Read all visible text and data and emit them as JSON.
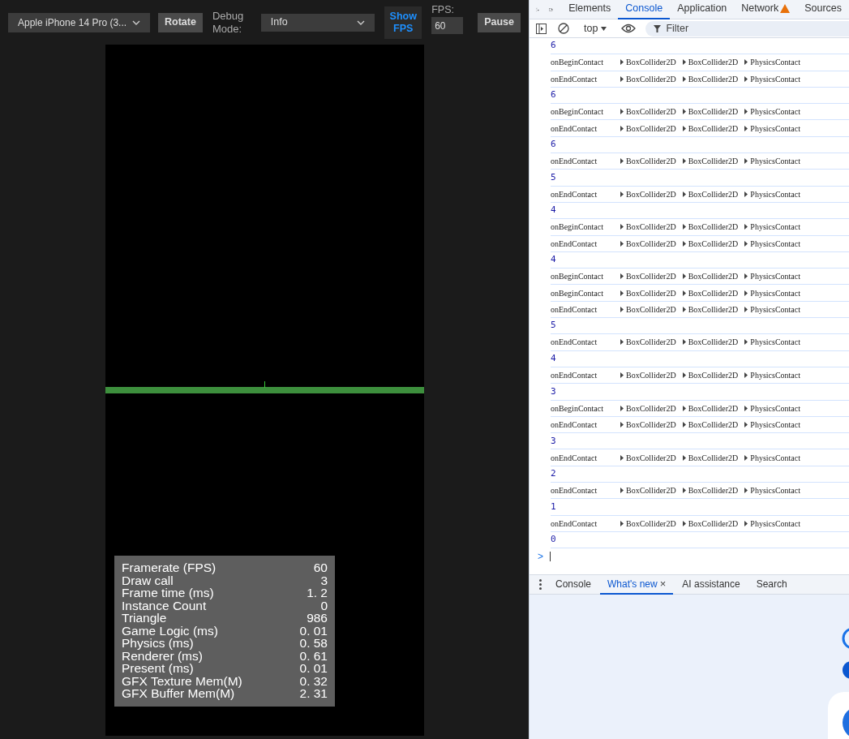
{
  "toolbar": {
    "device": "Apple iPhone 14 Pro (3...",
    "rotate": "Rotate",
    "debug_label": "Debug Mode:",
    "debug_mode": "Info",
    "show_fps": "Show FPS",
    "show_fps_on": true,
    "fps_label": "FPS:",
    "fps_value": "60",
    "pause": "Pause"
  },
  "stats": [
    {
      "label": "Framerate (FPS)",
      "value": "60"
    },
    {
      "label": "Draw call",
      "value": "3"
    },
    {
      "label": "Frame time (ms)",
      "value": "1. 2"
    },
    {
      "label": "Instance Count",
      "value": "0"
    },
    {
      "label": "Triangle",
      "value": "986"
    },
    {
      "label": "Game Logic (ms)",
      "value": "0. 01"
    },
    {
      "label": "Physics (ms)",
      "value": "0. 58"
    },
    {
      "label": "Renderer (ms)",
      "value": "0. 61"
    },
    {
      "label": "Present (ms)",
      "value": "0. 01"
    },
    {
      "label": "GFX Texture Mem(M)",
      "value": "0. 32"
    },
    {
      "label": "GFX Buffer Mem(M)",
      "value": "2. 31"
    }
  ],
  "devtools": {
    "tabs": [
      {
        "label": "Elements",
        "selected": false,
        "warning": false
      },
      {
        "label": "Console",
        "selected": true,
        "warning": false
      },
      {
        "label": "Application",
        "selected": false,
        "warning": false
      },
      {
        "label": "Network",
        "selected": false,
        "warning": true
      },
      {
        "label": "Sources",
        "selected": false,
        "warning": false
      }
    ],
    "context": "top",
    "filter_placeholder": "Filter",
    "console": [
      {
        "kind": "number",
        "text": "6"
      },
      {
        "kind": "log",
        "text": "onBeginContact",
        "args": [
          "BoxCollider2D",
          "BoxCollider2D",
          "PhysicsContact"
        ]
      },
      {
        "kind": "log",
        "text": "onEndContact",
        "args": [
          "BoxCollider2D",
          "BoxCollider2D",
          "PhysicsContact"
        ]
      },
      {
        "kind": "number",
        "text": "6"
      },
      {
        "kind": "log",
        "text": "onBeginContact",
        "args": [
          "BoxCollider2D",
          "BoxCollider2D",
          "PhysicsContact"
        ]
      },
      {
        "kind": "log",
        "text": "onEndContact",
        "args": [
          "BoxCollider2D",
          "BoxCollider2D",
          "PhysicsContact"
        ]
      },
      {
        "kind": "number",
        "text": "6"
      },
      {
        "kind": "log",
        "text": "onEndContact",
        "args": [
          "BoxCollider2D",
          "BoxCollider2D",
          "PhysicsContact"
        ]
      },
      {
        "kind": "number",
        "text": "5"
      },
      {
        "kind": "log",
        "text": "onEndContact",
        "args": [
          "BoxCollider2D",
          "BoxCollider2D",
          "PhysicsContact"
        ]
      },
      {
        "kind": "number",
        "text": "4"
      },
      {
        "kind": "log",
        "text": "onBeginContact",
        "args": [
          "BoxCollider2D",
          "BoxCollider2D",
          "PhysicsContact"
        ]
      },
      {
        "kind": "log",
        "text": "onEndContact",
        "args": [
          "BoxCollider2D",
          "BoxCollider2D",
          "PhysicsContact"
        ]
      },
      {
        "kind": "number",
        "text": "4"
      },
      {
        "kind": "log",
        "text": "onBeginContact",
        "args": [
          "BoxCollider2D",
          "BoxCollider2D",
          "PhysicsContact"
        ]
      },
      {
        "kind": "log",
        "text": "onBeginContact",
        "args": [
          "BoxCollider2D",
          "BoxCollider2D",
          "PhysicsContact"
        ]
      },
      {
        "kind": "log",
        "text": "onEndContact",
        "args": [
          "BoxCollider2D",
          "BoxCollider2D",
          "PhysicsContact"
        ]
      },
      {
        "kind": "number",
        "text": "5"
      },
      {
        "kind": "log",
        "text": "onEndContact",
        "args": [
          "BoxCollider2D",
          "BoxCollider2D",
          "PhysicsContact"
        ]
      },
      {
        "kind": "number",
        "text": "4"
      },
      {
        "kind": "log",
        "text": "onEndContact",
        "args": [
          "BoxCollider2D",
          "BoxCollider2D",
          "PhysicsContact"
        ]
      },
      {
        "kind": "number",
        "text": "3"
      },
      {
        "kind": "log",
        "text": "onBeginContact",
        "args": [
          "BoxCollider2D",
          "BoxCollider2D",
          "PhysicsContact"
        ]
      },
      {
        "kind": "log",
        "text": "onEndContact",
        "args": [
          "BoxCollider2D",
          "BoxCollider2D",
          "PhysicsContact"
        ]
      },
      {
        "kind": "number",
        "text": "3"
      },
      {
        "kind": "log",
        "text": "onEndContact",
        "args": [
          "BoxCollider2D",
          "BoxCollider2D",
          "PhysicsContact"
        ]
      },
      {
        "kind": "number",
        "text": "2"
      },
      {
        "kind": "log",
        "text": "onEndContact",
        "args": [
          "BoxCollider2D",
          "BoxCollider2D",
          "PhysicsContact"
        ]
      },
      {
        "kind": "number",
        "text": "1"
      },
      {
        "kind": "log",
        "text": "onEndContact",
        "args": [
          "BoxCollider2D",
          "BoxCollider2D",
          "PhysicsContact"
        ]
      },
      {
        "kind": "number",
        "text": "0"
      }
    ],
    "prompt": ">",
    "drawer_tabs": [
      {
        "label": "Console",
        "selected": false,
        "closable": false
      },
      {
        "label": "What's new",
        "selected": true,
        "closable": true
      },
      {
        "label": "AI assistance",
        "selected": false,
        "closable": false
      },
      {
        "label": "Search",
        "selected": false,
        "closable": false
      }
    ],
    "close_glyph": "×"
  }
}
